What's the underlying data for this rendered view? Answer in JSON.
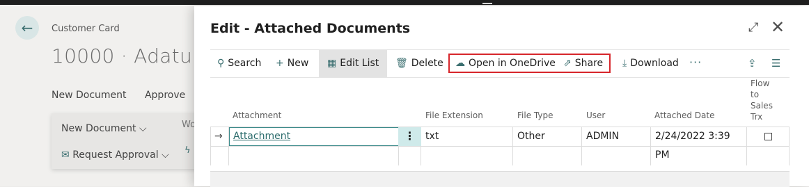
{
  "background": {
    "caption": "Customer Card",
    "title": "10000 · Adatum",
    "actions": [
      "New Document",
      "Approve"
    ],
    "panel_items": [
      "New Document",
      "Request Approval"
    ],
    "fragment": "Wo"
  },
  "dialog": {
    "title": "Edit - Attached Documents",
    "toolbar": {
      "search": "Search",
      "new": "New",
      "edit_list": "Edit List",
      "delete": "Delete",
      "open_onedrive": "Open in OneDrive",
      "share": "Share",
      "download": "Download",
      "more": "···"
    },
    "columns": {
      "attachment": "Attachment",
      "file_extension": "File Extension",
      "file_type": "File Type",
      "user": "User",
      "attached_date": "Attached Date",
      "flow": [
        "Flow",
        "to",
        "Sales",
        "Trx"
      ]
    },
    "rows": [
      {
        "attachment": "Attachment",
        "file_extension": "txt",
        "file_type": "Other",
        "user": "ADMIN",
        "attached_date": "2/24/2022 3:39 PM",
        "flow_to_sales_trx": false
      }
    ]
  },
  "colors": {
    "accent": "#3b6f70",
    "highlight": "#d7262b"
  }
}
